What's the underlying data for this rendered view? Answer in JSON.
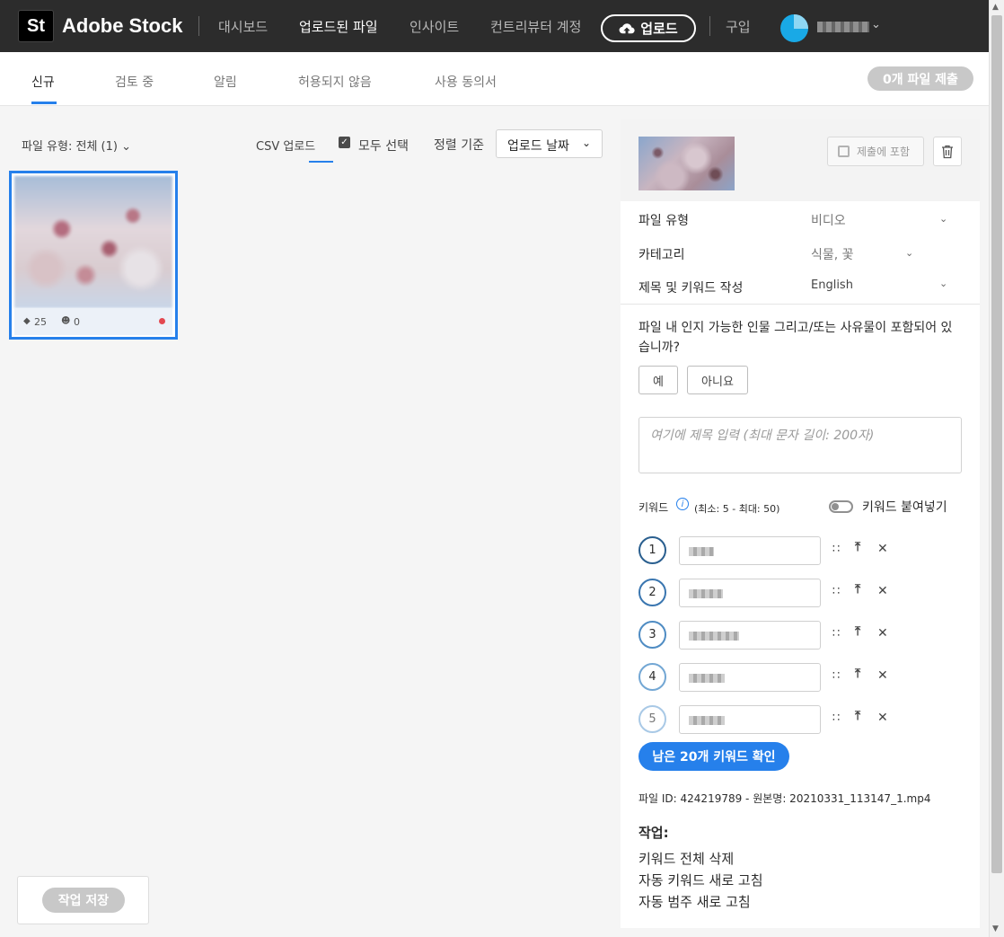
{
  "brand": {
    "logo_text": "St",
    "name": "Adobe Stock"
  },
  "nav": {
    "items": [
      {
        "label": "대시보드",
        "active": false
      },
      {
        "label": "업로드된 파일",
        "active": true
      },
      {
        "label": "인사이트",
        "active": false
      },
      {
        "label": "컨트리뷰터 계정",
        "active": false
      }
    ],
    "upload_label": "업로드",
    "buy_label": "구입"
  },
  "tabs": {
    "items": [
      {
        "label": "신규",
        "active": true
      },
      {
        "label": "검토 중",
        "active": false
      },
      {
        "label": "알림",
        "active": false
      },
      {
        "label": "허용되지 않음",
        "active": false
      },
      {
        "label": "사용 동의서",
        "active": false
      }
    ],
    "submit_label": "0개 파일 제출"
  },
  "toolbar": {
    "filter_label": "파일 유형: 전체 (1)",
    "csv_label": "CSV 업로드",
    "select_all_label": "모두 선택",
    "sort_label": "정렬 기준",
    "sort_value": "업로드 날짜"
  },
  "thumbnail": {
    "keyword_count": "25",
    "people_count": "0"
  },
  "save_label": "작업 저장",
  "panel": {
    "include_label": "제출에 포함",
    "file_type_label": "파일 유형",
    "file_type_value": "비디오",
    "category_label": "카테고리",
    "category_value": "식물, 꽃",
    "title_kw_label": "제목 및 키워드 작성",
    "title_kw_value": "English",
    "question": "파일 내 인지 가능한 인물 그리고/또는 사유물이 포함되어 있습니까?",
    "yes_label": "예",
    "no_label": "아니요",
    "title_placeholder": "여기에 제목 입력 (최대 문자 길이: 200자)",
    "keywords_label": "키워드",
    "keywords_range": "(최소: 5 - 최대: 50)",
    "paste_label": "키워드 붙여넣기",
    "keyword_numbers": [
      "1",
      "2",
      "3",
      "4",
      "5"
    ],
    "more_keywords_label": "남은 20개 키워드 확인",
    "file_id_text": "파일 ID: 424219789 - 원본명: 20210331_113147_1.mp4",
    "actions_title": "작업:",
    "actions": [
      "키워드 전체 삭제",
      "자동 키워드 새로 고침",
      "자동 범주 새로 고침"
    ]
  },
  "colors": {
    "accent": "#2680eb",
    "topbar": "#2c2c2c",
    "notice_dot": "#e34850"
  }
}
